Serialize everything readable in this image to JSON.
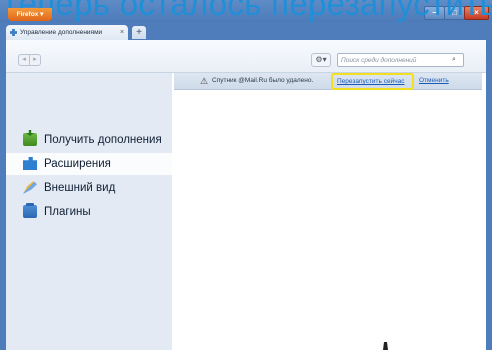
{
  "caption": "Теперь осталось перезапустить",
  "window": {
    "app_button": "Firefox ▾",
    "minimize": "–",
    "maximize": "□",
    "close": "×"
  },
  "tabs": [
    {
      "label": "Управление дополнениями",
      "close": "×"
    }
  ],
  "newtab_label": "+",
  "toolbar": {
    "back": "◂",
    "forward": "▸",
    "gear": "⚙▾",
    "search_placeholder": "Поиск среди дополнений",
    "search_value": "",
    "search_icon": "⌕"
  },
  "sidebar": {
    "items": [
      {
        "label": "Получить дополнения",
        "icon": "get-addons-icon",
        "selected": false
      },
      {
        "label": "Расширения",
        "icon": "puzzle-icon",
        "selected": true
      },
      {
        "label": "Внешний вид",
        "icon": "brush-icon",
        "selected": false
      },
      {
        "label": "Плагины",
        "icon": "plugin-icon",
        "selected": false
      }
    ]
  },
  "notice": {
    "icon": "⚠",
    "message": "Спутник @Mail.Ru было удалено.",
    "restart_link": "Перезапустить сейчас",
    "cancel_link": "Отменить",
    "highlight_color": "#f2e020"
  },
  "colors": {
    "frame": "#4f7dbb",
    "firefox_button": "#e97a26",
    "link": "#1b5bb8",
    "caption": "#1f8fd8"
  }
}
